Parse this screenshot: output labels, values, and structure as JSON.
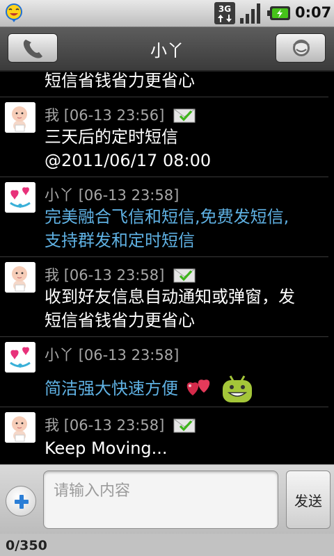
{
  "status_bar": {
    "network": "3G",
    "time": "0:07",
    "icons": [
      "app-face-icon",
      "3g-data-icon",
      "signal-strength-icon",
      "battery-charging-icon"
    ]
  },
  "title_bar": {
    "title": "小丫",
    "left_button_icon": "phone-icon",
    "right_button_icon": "contact-icon"
  },
  "messages": [
    {
      "sender": "",
      "time": "",
      "text": "短信省钱省力更省心",
      "from_me": true,
      "partial": true
    },
    {
      "sender": "我",
      "time": "[06-13 23:56]",
      "text": "三天后的定时短信 @2011/06/17 08:00",
      "lines": [
        "三天后的定时短信",
        "@2011/06/17 08:00"
      ],
      "from_me": true,
      "delivered": true
    },
    {
      "sender": "小丫",
      "time": "[06-13 23:58]",
      "lines": [
        "完美融合飞信和短信,免费发短信,",
        "支持群发和定时短信"
      ],
      "from_me": false
    },
    {
      "sender": "我",
      "time": "[06-13 23:58]",
      "lines": [
        "收到好友信息自动通知或弹窗，发",
        "短信省钱省力更省心"
      ],
      "from_me": true,
      "delivered": true
    },
    {
      "sender": "小丫",
      "time": "[06-13 23:58]",
      "lines": [
        "简洁强大快速方便"
      ],
      "from_me": false,
      "emoticons": [
        "hearts-emoticon",
        "android-smile-emoticon"
      ]
    },
    {
      "sender": "我",
      "time": "[06-13 23:58]",
      "lines": [
        "Keep Moving..."
      ],
      "from_me": true,
      "delivered": true
    }
  ],
  "composer": {
    "placeholder": "请输入内容",
    "value": "",
    "send_label": "发送",
    "counter": "0/350"
  },
  "colors": {
    "incoming_text": "#5fb1e3",
    "outgoing_text": "#ffffff",
    "meta_text": "#a7a7a7",
    "background": "#000000"
  }
}
